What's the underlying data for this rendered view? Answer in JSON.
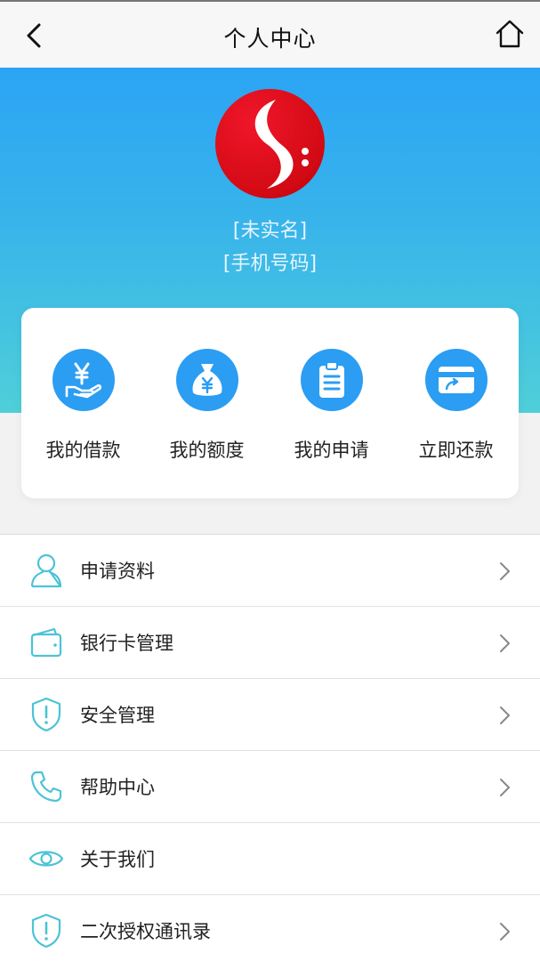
{
  "header": {
    "title": "个人中心"
  },
  "profile": {
    "name": "[未实名]",
    "phone": "[手机号码]"
  },
  "quick_actions": [
    {
      "label": "我的借款",
      "icon": "loan-hand-yen-icon"
    },
    {
      "label": "我的额度",
      "icon": "money-bag-icon"
    },
    {
      "label": "我的申请",
      "icon": "clipboard-icon"
    },
    {
      "label": "立即还款",
      "icon": "card-repay-icon"
    }
  ],
  "menu": [
    {
      "label": "申请资料",
      "icon": "user-icon",
      "chevron": true
    },
    {
      "label": "银行卡管理",
      "icon": "wallet-icon",
      "chevron": true
    },
    {
      "label": "安全管理",
      "icon": "shield-icon",
      "chevron": true
    },
    {
      "label": "帮助中心",
      "icon": "phone-icon",
      "chevron": true
    },
    {
      "label": "关于我们",
      "icon": "eye-icon",
      "chevron": false
    },
    {
      "label": "二次授权通讯录",
      "icon": "shield-icon",
      "chevron": true
    }
  ],
  "colors": {
    "accent": "#2b9df2",
    "gradient_top": "#2ba4f4",
    "gradient_bottom": "#4fcfd9",
    "list_icon": "#4cc3d6",
    "logo_red": "#d20a14"
  }
}
